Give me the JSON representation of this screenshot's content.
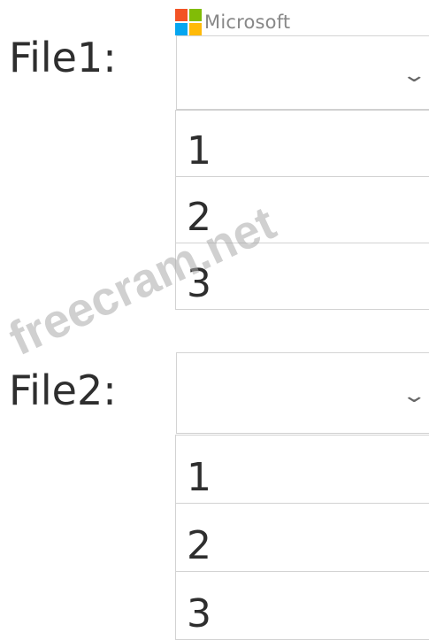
{
  "brand": {
    "name": "Microsoft",
    "logo_colors": [
      "#f35325",
      "#81bc06",
      "#05a6f0",
      "#ffba08"
    ]
  },
  "file1": {
    "label": "File1:",
    "selected_value": "",
    "options": [
      "1",
      "2",
      "3"
    ]
  },
  "file2": {
    "label": "File2:",
    "selected_value": "",
    "options": [
      "1",
      "2",
      "3"
    ]
  },
  "icons": {
    "dropdown": "chevron-down-icon"
  },
  "watermark": "freecram.net"
}
